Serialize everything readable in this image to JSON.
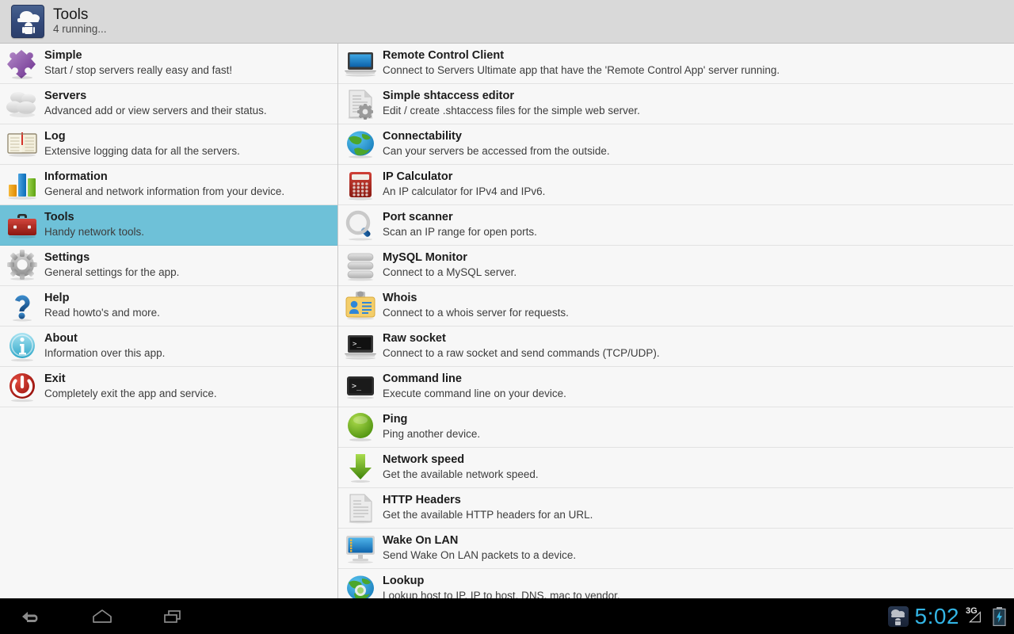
{
  "header": {
    "title": "Tools",
    "subtitle": "4 running...",
    "logo_icon": "cloud-android-icon"
  },
  "sidebar": {
    "selected_index": 4,
    "highlight_color": "#6EC1D8",
    "items": [
      {
        "icon": "puzzle-icon",
        "title": "Simple",
        "desc": "Start / stop servers really easy and fast!"
      },
      {
        "icon": "clouds-icon",
        "title": "Servers",
        "desc": "Advanced add or view servers and their status."
      },
      {
        "icon": "book-icon",
        "title": "Log",
        "desc": "Extensive logging data for all the servers."
      },
      {
        "icon": "bar-chart-icon",
        "title": "Information",
        "desc": "General and network information from your device."
      },
      {
        "icon": "toolbox-icon",
        "title": "Tools",
        "desc": "Handy network tools."
      },
      {
        "icon": "gear-icon",
        "title": "Settings",
        "desc": "General settings for the app."
      },
      {
        "icon": "question-icon",
        "title": "Help",
        "desc": "Read howto's and more."
      },
      {
        "icon": "info-icon",
        "title": "About",
        "desc": "Information over this app."
      },
      {
        "icon": "power-icon",
        "title": "Exit",
        "desc": "Completely exit the app and service."
      }
    ]
  },
  "main": {
    "items": [
      {
        "icon": "laptop-blue-icon",
        "title": "Remote Control Client",
        "desc": "Connect to Servers Ultimate app that have the 'Remote Control App' server running."
      },
      {
        "icon": "document-gear-icon",
        "title": "Simple shtaccess editor",
        "desc": "Edit / create .shtaccess files for the simple web server."
      },
      {
        "icon": "globe-icon",
        "title": "Connectability",
        "desc": "Can your servers be accessed from the outside."
      },
      {
        "icon": "calculator-icon",
        "title": "IP Calculator",
        "desc": "An IP calculator for IPv4 and IPv6."
      },
      {
        "icon": "magnifier-icon",
        "title": "Port scanner",
        "desc": "Scan an IP range for open ports."
      },
      {
        "icon": "database-icon",
        "title": "MySQL Monitor",
        "desc": "Connect to a MySQL server."
      },
      {
        "icon": "id-card-icon",
        "title": "Whois",
        "desc": "Connect to a whois server for requests."
      },
      {
        "icon": "laptop-terminal-icon",
        "title": "Raw socket",
        "desc": "Connect to a raw socket and send commands (TCP/UDP)."
      },
      {
        "icon": "terminal-icon",
        "title": "Command line",
        "desc": "Execute command line on your device."
      },
      {
        "icon": "green-circle-icon",
        "title": "Ping",
        "desc": "Ping another device."
      },
      {
        "icon": "down-arrow-icon",
        "title": "Network speed",
        "desc": "Get the available network speed."
      },
      {
        "icon": "document-icon",
        "title": "HTTP Headers",
        "desc": "Get the available HTTP headers for an URL."
      },
      {
        "icon": "monitor-icon",
        "title": "Wake On LAN",
        "desc": "Send Wake On LAN packets to a device."
      },
      {
        "icon": "globe-dns-icon",
        "title": "Lookup",
        "desc": "Lookup host to IP, IP to host, DNS, mac to vendor."
      }
    ]
  },
  "navbar": {
    "back_icon": "back-arrow-icon",
    "home_icon": "home-icon",
    "recents_icon": "recent-apps-icon",
    "notification_icon": "cloud-android-notification-icon",
    "time": "5:02",
    "network": "3G",
    "battery_icon": "battery-charging-icon",
    "accent_color": "#33B5E5"
  }
}
